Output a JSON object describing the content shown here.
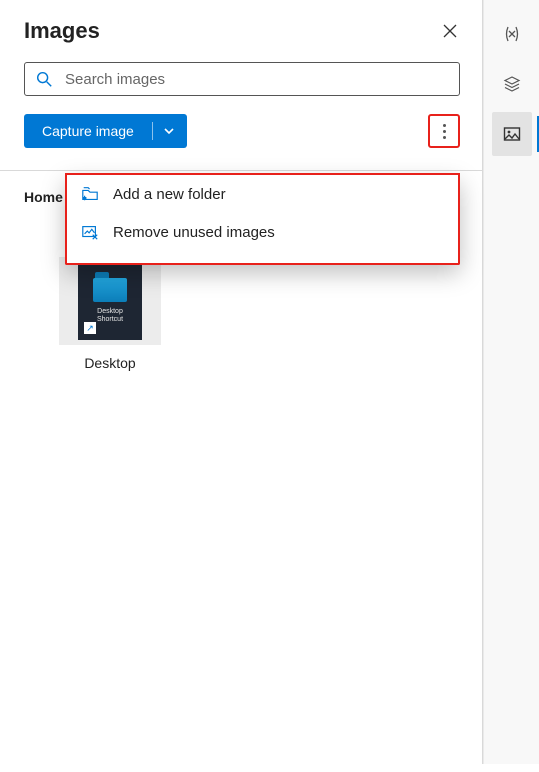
{
  "panel": {
    "title": "Images",
    "search_placeholder": "Search images",
    "capture_label": "Capture image",
    "more_aria": "More options"
  },
  "menu": {
    "add_folder": "Add a new folder",
    "remove_unused": "Remove unused images"
  },
  "breadcrumb": "Home",
  "thumbs": [
    {
      "caption": "Desktop",
      "tile_text1": "Desktop",
      "tile_text2": "Shortcut"
    }
  ],
  "rail": {
    "variables": "Variables",
    "layers": "Layers",
    "images": "Images"
  }
}
